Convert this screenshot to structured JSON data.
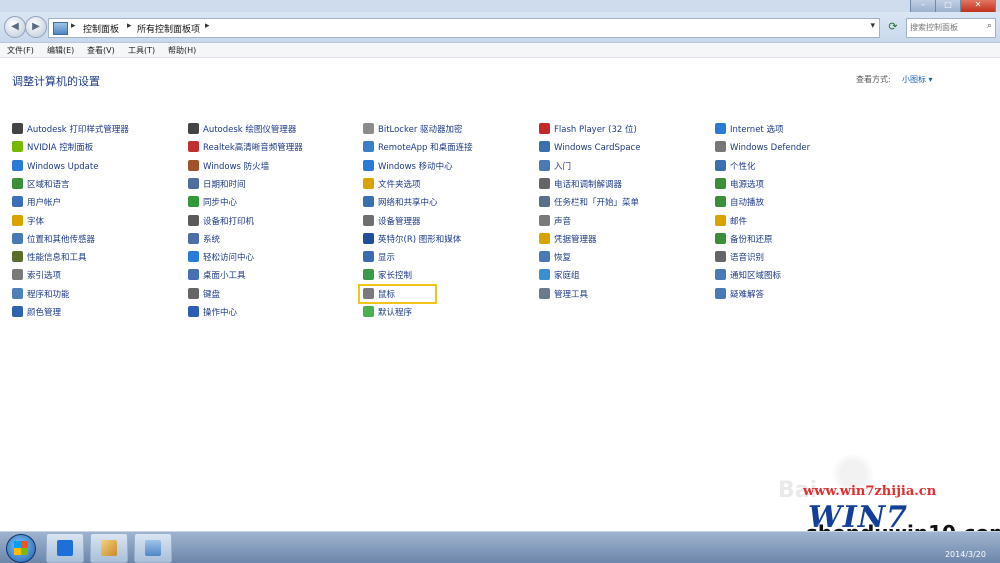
{
  "breadcrumb": {
    "seg1": "控制面板",
    "seg2": "所有控制面板项"
  },
  "search": {
    "placeholder": "搜索控制面板"
  },
  "menu": [
    "文件(F)",
    "编辑(E)",
    "查看(V)",
    "工具(T)",
    "帮助(H)"
  ],
  "page": {
    "title": "调整计算机的设置",
    "view_by_label": "查看方式:",
    "view_by_value": "小图标 ▾"
  },
  "items": [
    [
      "Autodesk 打印样式管理器",
      "NVIDIA 控制面板",
      "Windows Update",
      "区域和语言",
      "用户帐户",
      "字体",
      "位置和其他传感器",
      "性能信息和工具",
      "索引选项",
      "程序和功能",
      "颜色管理"
    ],
    [
      "Autodesk 绘图仪管理器",
      "Realtek高清晰音频管理器",
      "Windows 防火墙",
      "日期和时间",
      "同步中心",
      "设备和打印机",
      "系统",
      "轻松访问中心",
      "桌面小工具",
      "键盘",
      "操作中心"
    ],
    [
      "BitLocker 驱动器加密",
      "RemoteApp 和桌面连接",
      "Windows 移动中心",
      "文件夹选项",
      "网络和共享中心",
      "设备管理器",
      "英特尔(R) 图形和媒体",
      "显示",
      "家长控制",
      "鼠标",
      "默认程序"
    ],
    [
      "Flash Player (32 位)",
      "Windows CardSpace",
      "入门",
      "电话和调制解调器",
      "任务栏和「开始」菜单",
      "声音",
      "凭据管理器",
      "恢复",
      "家庭组",
      "管理工具"
    ],
    [
      "Internet 选项",
      "Windows Defender",
      "个性化",
      "电源选项",
      "自动播放",
      "邮件",
      "备份和还原",
      "语音识别",
      "通知区域图标",
      "疑难解答"
    ]
  ],
  "icon_colors": [
    [
      "#444444",
      "#76b900",
      "#2a7bd6",
      "#3a8f3a",
      "#3c6fb8",
      "#d9a300",
      "#4a7ab5",
      "#5b6e2a",
      "#7a7a7a",
      "#4f7fb8",
      "#2f63b0"
    ],
    [
      "#444444",
      "#c03030",
      "#a0522d",
      "#4e6e9e",
      "#2f9a3a",
      "#5a5a5a",
      "#4a6fa8",
      "#2a7bd6",
      "#4670b0",
      "#666666",
      "#2a5fb5"
    ],
    [
      "#8c8c8c",
      "#3b7fc4",
      "#2a7bd6",
      "#d9a300",
      "#3a6fb0",
      "#6f6f6f",
      "#1f4f9a",
      "#3b6db4",
      "#3a9a4a",
      "#7a7a7a",
      "#4caf50"
    ],
    [
      "#c62828",
      "#3a6fb0",
      "#4a7ab5",
      "#666666",
      "#5a6f8a",
      "#7a7a7a",
      "#d9a300",
      "#4a7ab5",
      "#3a8fcf",
      "#6a7a8a"
    ],
    [
      "#2a7bd6",
      "#777777",
      "#3a6fb0",
      "#3a8f3a",
      "#3a8f3a",
      "#d9a300",
      "#3a8f3a",
      "#666666",
      "#4a7ab5",
      "#4a7ab5"
    ]
  ],
  "watermark": {
    "site1": "www.win7zhijia.cn",
    "win7": "WIN7",
    "site2": "shenduwin10.com",
    "bai": "Bai"
  },
  "taskbar": {
    "date": "2014/3/20"
  }
}
